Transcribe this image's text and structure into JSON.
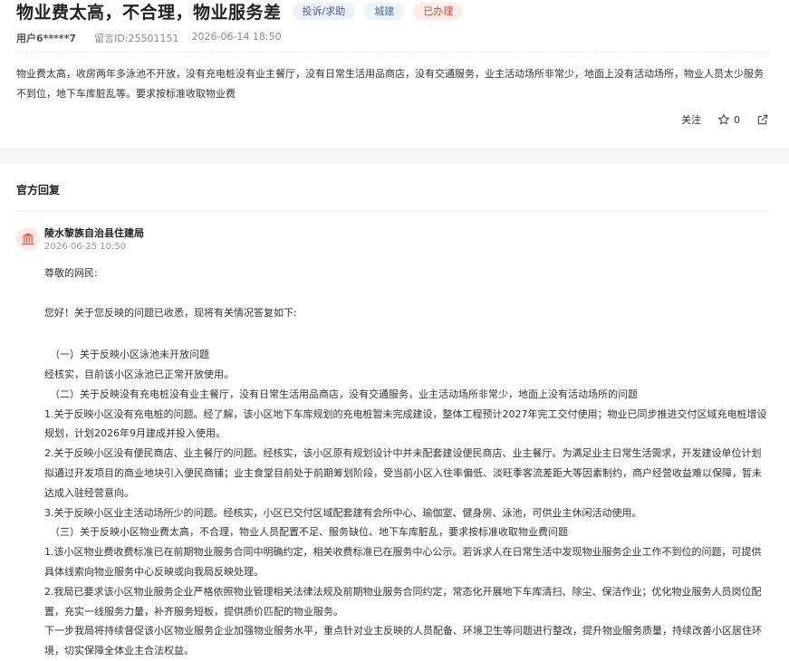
{
  "post": {
    "title": "物业费太高，不合理，物业服务差",
    "tags": {
      "type": "投诉/求助",
      "category": "城建",
      "status": "已办理"
    },
    "user": "用户6*****7",
    "message_id": "留言ID:25501151",
    "time": "2026-06-14 18:50",
    "content": "物业费太高，收房两年多泳池不开放，没有充电桩没有业主餐厅，没有日常生活用品商店，没有交通服务，业主活动场所非常少，地面上没有活动场所，物业人员太少服务不到位，地下车库脏乱等。要求按标准收取物业费",
    "actions": {
      "follow_label": "关注",
      "like_count": "0",
      "follow_icon": "none",
      "star_icon": "star-outline-icon",
      "share_icon": "share-icon"
    }
  },
  "reply_section": {
    "title": "官方回复",
    "org_icon": "government-building-icon",
    "org": "陵水黎族自治县住建局",
    "time": "2026-06-25 10:50",
    "greeting": "尊敬的网民:",
    "intro": "您好！关于您反映的问题已收悉，现将有关情况答复如下:",
    "paragraphs": [
      "（一）关于反映小区泳池未开放问题",
      "经核实，目前该小区泳池已正常开放使用。",
      "（二）关于反映没有充电桩没有业主餐厅，没有日常生活用品商店，没有交通服务，业主活动场所非常少，地面上没有活动场所的问题",
      "1.关于反映小区没有充电桩的问题。经了解，该小区地下车库规划的充电桩暂未完成建设，整体工程预计2027年完工交付使用；物业已同步推进交付区域充电桩增设规划，计划2026年9月建成并投入使用。",
      "2.关于反映小区没有便民商店、业主餐厅的问题。经核实，该小区原有规划设计中并未配套建设便民商店、业主餐厅。为满足业主日常生活需求，开发建设单位计划拟通过开发项目的商业地块引入便民商铺；业主食堂目前处于前期筹划阶段，受当前小区入住率偏低、淡旺季客流差距大等因素制约，商户经营收益难以保障，暂未达成入驻经营意向。",
      "3.关于反映小区业主活动场所少的问题。经核实，小区已交付区域配套建有会所中心、瑜伽室、健身房、泳池，可供业主休闲活动使用。",
      "（三）关于反映小区物业费太高，不合理，物业人员配置不足、服务缺位、地下车库脏乱，要求按标准收取物业费问题",
      "1.该小区物业费收费标准已在前期物业服务合同中明确约定，相关收费标准已在服务中心公示。若诉求人在日常生活中发现物业服务企业工作不到位的问题，可提供具体线索向物业服务中心反映或向我局反映处理。",
      "2.我局已要求该小区物业服务企业严格依照物业管理相关法律法规及前期物业服务合同约定，常态化开展地下车库清扫、除尘、保洁作业；优化物业服务人员岗位配置，充实一线服务力量，补齐服务短板，提供质价匹配的物业服务。",
      "下一步我局将持续督促该小区物业服务企业加强物业服务水平，重点针对业主反映的人员配备、环境卫生等问题进行整改，提升物业服务质量，持续改善小区居住环境，切实保障全体业主合法权益。"
    ]
  }
}
